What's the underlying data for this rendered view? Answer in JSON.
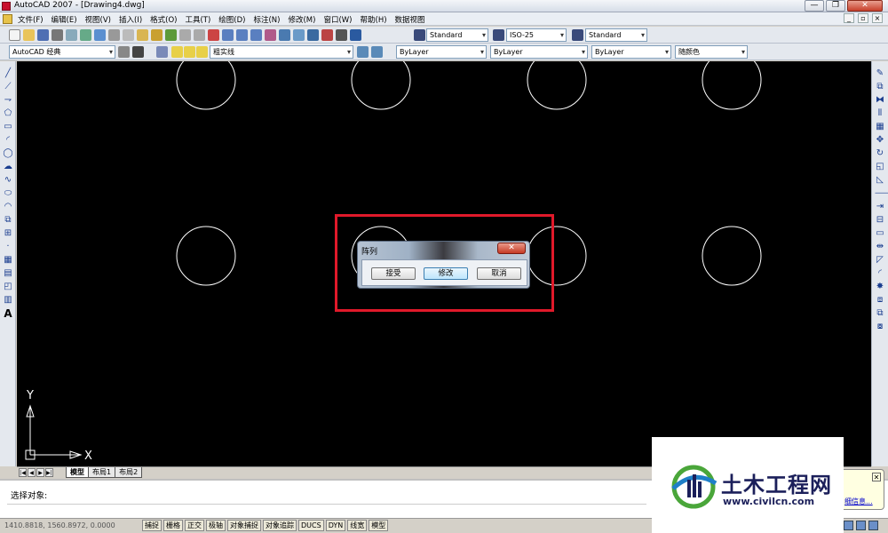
{
  "window": {
    "title": "AutoCAD 2007 - [Drawing4.dwg]",
    "min": "—",
    "max": "❐",
    "close": "✕"
  },
  "menu": [
    "文件(F)",
    "编辑(E)",
    "视图(V)",
    "插入(I)",
    "格式(O)",
    "工具(T)",
    "绘图(D)",
    "标注(N)",
    "修改(M)",
    "窗口(W)",
    "帮助(H)",
    "数据视图"
  ],
  "mdi": {
    "min": "_",
    "max": "▫",
    "close": "×"
  },
  "toolbar1": {
    "text_style": "Standard",
    "dim_style": "ISO-25",
    "table_style": "Standard"
  },
  "toolbar2": {
    "workspace": "AutoCAD 经典",
    "layer": "粗实线",
    "color": "ByLayer",
    "linetype": "ByLayer",
    "lineweight": "ByLayer",
    "plot_style": "随颜色"
  },
  "ucs": {
    "y": "Y",
    "x": "X"
  },
  "layout_tabs": {
    "nav": [
      "|◀",
      "◀",
      "▶",
      "▶|"
    ],
    "tabs": [
      "模型",
      "布局1",
      "布局2"
    ],
    "active": 0
  },
  "command": {
    "prompt": "选择对象:"
  },
  "status": {
    "coords": "1410.8818, 1560.8972, 0.0000",
    "buttons": [
      "捕捉",
      "栅格",
      "正交",
      "极轴",
      "对象捕捉",
      "对象追踪",
      "DUCS",
      "DYN",
      "线宽",
      "模型"
    ]
  },
  "bubble": {
    "close": "✕",
    "link": "细信息..."
  },
  "dialog": {
    "title": "阵列",
    "close": "✕",
    "buttons": {
      "accept": "接受",
      "modify": "修改",
      "cancel": "取消"
    }
  },
  "watermark": {
    "name": "土木工程网",
    "url": "www.civilcn.com"
  },
  "colors": {
    "canvas": "#000000",
    "highlight": "#e0192a",
    "circle": "#ffffff"
  }
}
